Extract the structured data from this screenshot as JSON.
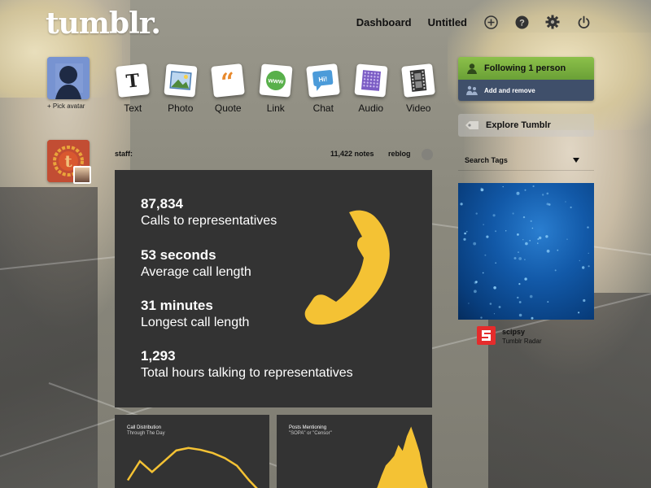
{
  "header": {
    "logo": "tumblr.",
    "nav": {
      "dashboard": "Dashboard",
      "untitled": "Untitled"
    },
    "icons": [
      "plus-icon",
      "help-icon",
      "gear-icon",
      "power-icon"
    ]
  },
  "user": {
    "pick_avatar": "+ Pick avatar"
  },
  "post_types": [
    {
      "label": "Text",
      "icon": "text-post-icon",
      "glyph": "T",
      "color": "#222222"
    },
    {
      "label": "Photo",
      "icon": "photo-post-icon",
      "glyph": "",
      "color": "#6fa3d8"
    },
    {
      "label": "Quote",
      "icon": "quote-post-icon",
      "glyph": "“",
      "color": "#e8892d"
    },
    {
      "label": "Link",
      "icon": "link-post-icon",
      "glyph": "www",
      "color": "#59b04b"
    },
    {
      "label": "Chat",
      "icon": "chat-post-icon",
      "glyph": "Hi!",
      "color": "#4c9bd9"
    },
    {
      "label": "Audio",
      "icon": "audio-post-icon",
      "glyph": "",
      "color": "#7b5cc4"
    },
    {
      "label": "Video",
      "icon": "video-post-icon",
      "glyph": "",
      "color": "#333333"
    }
  ],
  "post": {
    "author": "staff:",
    "notes": "11,422 notes",
    "reblog": "reblog",
    "stats": [
      {
        "value": "87,834",
        "label": "Calls to representatives"
      },
      {
        "value": "53 seconds",
        "label": "Average call length"
      },
      {
        "value": "31 minutes",
        "label": "Longest call length"
      },
      {
        "value": "1,293",
        "label": "Total hours talking to representatives"
      }
    ],
    "accent_color": "#f4c234",
    "charts": {
      "left": {
        "title": "Call Distribution",
        "subtitle": "Through The Day"
      },
      "right": {
        "title": "Posts Mentioning",
        "subtitle": "\"SOPA\" or \"Censor\""
      }
    }
  },
  "sidebar": {
    "following": "Following 1 person",
    "add_remove": "Add and remove",
    "explore": "Explore Tumblr",
    "search_tags": "Search Tags",
    "radar": {
      "name": "scipsy",
      "label": "Tumblr Radar"
    }
  },
  "chart_data": [
    {
      "type": "line",
      "title": "Call Distribution",
      "subtitle": "Through The Day",
      "values": [
        0.25,
        0.55,
        0.38,
        0.55,
        0.72,
        0.76,
        0.73,
        0.68,
        0.6,
        0.48,
        0.25,
        0.05
      ]
    },
    {
      "type": "area",
      "title": "Posts Mentioning",
      "subtitle": "\"SOPA\" or \"Censor\"",
      "values": [
        0.02,
        0.03,
        0.05,
        0.12,
        0.28,
        0.42,
        0.48,
        0.55,
        0.7,
        0.62,
        0.82,
        0.95,
        0.78,
        0.6,
        0.3,
        0.1
      ]
    }
  ]
}
